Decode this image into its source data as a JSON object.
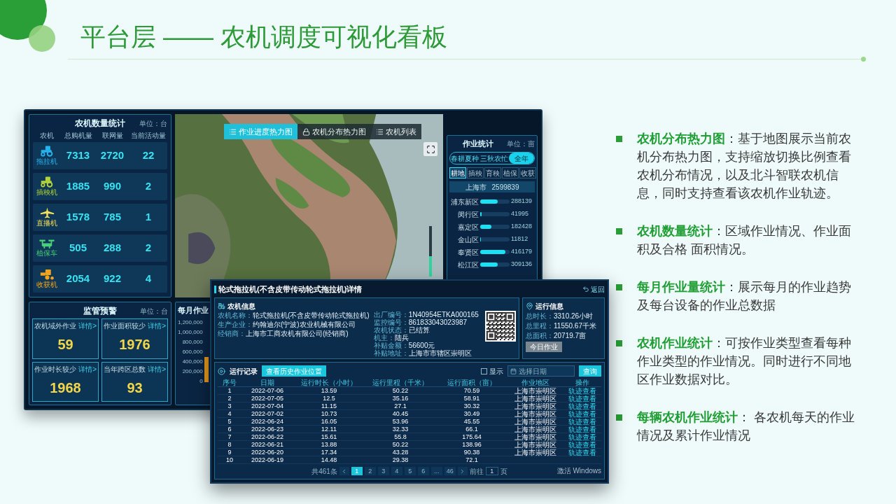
{
  "title": "平台层 —— 农机调度可视化看板",
  "dashboard": {
    "machine_stats": {
      "title": "农机数量统计",
      "unit": "单位：台",
      "columns": [
        "农机",
        "总购机量",
        "联网量",
        "当前活动量"
      ],
      "rows": [
        {
          "kind": "tractor",
          "name": "拖拉机",
          "color": "#25b4f0",
          "total": "7313",
          "online": "2720",
          "active": "22"
        },
        {
          "kind": "transplanter",
          "name": "插秧机",
          "color": "#b4d43a",
          "total": "1885",
          "online": "990",
          "active": "2"
        },
        {
          "kind": "seeder",
          "name": "直播机",
          "color": "#f2df5c",
          "total": "1578",
          "online": "785",
          "active": "1"
        },
        {
          "kind": "drone",
          "name": "植保车",
          "color": "#49d07a",
          "total": "505",
          "online": "288",
          "active": "2"
        },
        {
          "kind": "harvester",
          "name": "收获机",
          "color": "#f2a51c",
          "total": "2054",
          "online": "922",
          "active": "4"
        }
      ]
    },
    "warnings": {
      "title": "监管预警",
      "unit": "单位：台",
      "cards": [
        {
          "label": "农机域外作业",
          "link": "详情>",
          "value": "59"
        },
        {
          "label": "作业面积较少",
          "link": "详情>",
          "value": "1976"
        },
        {
          "label": "作业时长较少",
          "link": "详情>",
          "value": "1968"
        },
        {
          "label": "当年跨区总数",
          "link": "详情>",
          "value": "93"
        }
      ]
    },
    "map": {
      "tabs": [
        {
          "label": "作业进度热力图",
          "selected": true
        },
        {
          "label": "农机分布热力图",
          "selected": false
        },
        {
          "label": "农机列表",
          "selected": false
        }
      ],
      "zoom": {
        "level": 0.4
      }
    },
    "work_stats": {
      "title": "作业统计",
      "unit": "单位：亩",
      "seasons": [
        {
          "label": "春耕夏种",
          "selected": false
        },
        {
          "label": "三秋农忙",
          "selected": false
        },
        {
          "label": "全年",
          "selected": true
        }
      ],
      "types": [
        {
          "label": "耕地",
          "selected": true
        },
        {
          "label": "插秧",
          "selected": false
        },
        {
          "label": "育秧",
          "selected": false
        },
        {
          "label": "植保",
          "selected": false
        },
        {
          "label": "收获",
          "selected": false
        }
      ],
      "total": {
        "label": "上海市",
        "value": "2599839"
      },
      "districts": [
        {
          "name": "浦东新区",
          "level": 0.6,
          "value": "288139"
        },
        {
          "name": "闵行区",
          "level": 0.05,
          "value": "41995"
        },
        {
          "name": "嘉定区",
          "level": 0.37,
          "value": "182428"
        },
        {
          "name": "金山区",
          "level": 0.02,
          "value": "11812"
        },
        {
          "name": "奉贤区",
          "level": 0.85,
          "value": "416179"
        },
        {
          "name": "松江区",
          "level": 0.6,
          "value": "309136"
        }
      ]
    },
    "monthly": {
      "title": "每月作业",
      "y_labels": [
        "1,200,000",
        "1,000,000",
        "800,000",
        "600,000",
        "400,000",
        "200,000",
        "0"
      ]
    }
  },
  "detail": {
    "title": "轮式拖拉机(不含皮带传动轮式拖拉机)详情",
    "back": "返回",
    "machine_info": {
      "title": "农机信息",
      "columns": [
        [
          {
            "label": "农机名称：",
            "value": "轮式拖拉机(不含皮带传动轮式拖拉机)"
          },
          {
            "label": "生产企业：",
            "value": "约翰迪尔(宁波)农业机械有限公司"
          },
          {
            "label": "经销商：",
            "value": "上海市工商农机有限公司(经销商)"
          }
        ],
        [
          {
            "label": "出厂编号：",
            "value": "1N40954ETKA000165"
          },
          {
            "label": "监控编号：",
            "value": "861833043023987"
          },
          {
            "label": "农机状态：",
            "value": "已结算"
          }
        ],
        [
          {
            "label": "机主：",
            "value": "陆兵"
          },
          {
            "label": "补贴金额：",
            "value": "56600元"
          },
          {
            "label": "补贴地址：",
            "value": "上海市市辖区崇明区"
          }
        ]
      ]
    },
    "run_info": {
      "title": "运行信息",
      "fields": [
        {
          "label": "总时长：",
          "value": "3310.26小时"
        },
        {
          "label": "总里程：",
          "value": "11550.67千米"
        },
        {
          "label": "总面积：",
          "value": "20719.7亩"
        }
      ],
      "button": "今日作业"
    },
    "records": {
      "title": "运行记录",
      "history_button": "查看历史作业位置",
      "show": {
        "label": "显示",
        "checked": false
      },
      "date": {
        "placeholder": "选择日期"
      },
      "search_button": "查询",
      "columns": [
        "序号",
        "日期",
        "运行时长（小时）",
        "运行里程（千米）",
        "运行面积（亩）",
        "作业地区",
        "操作"
      ],
      "rows": [
        {
          "no": "1",
          "date": "2022-07-06",
          "hours": "13.59",
          "km": "50.22",
          "area": "70.59",
          "region": "上海市崇明区",
          "action": "轨迹查看"
        },
        {
          "no": "2",
          "date": "2022-07-05",
          "hours": "12.5",
          "km": "35.16",
          "area": "58.91",
          "region": "上海市崇明区",
          "action": "轨迹查看"
        },
        {
          "no": "3",
          "date": "2022-07-04",
          "hours": "11.15",
          "km": "27.1",
          "area": "30.32",
          "region": "上海市崇明区",
          "action": "轨迹查看"
        },
        {
          "no": "4",
          "date": "2022-07-02",
          "hours": "10.73",
          "km": "40.45",
          "area": "30.49",
          "region": "上海市崇明区",
          "action": "轨迹查看"
        },
        {
          "no": "5",
          "date": "2022-06-24",
          "hours": "16.05",
          "km": "53.96",
          "area": "45.55",
          "region": "上海市崇明区",
          "action": "轨迹查看"
        },
        {
          "no": "6",
          "date": "2022-06-23",
          "hours": "12.11",
          "km": "32.33",
          "area": "66.1",
          "region": "上海市崇明区",
          "action": "轨迹查看"
        },
        {
          "no": "7",
          "date": "2022-06-22",
          "hours": "15.61",
          "km": "55.8",
          "area": "175.64",
          "region": "上海市崇明区",
          "action": "轨迹查看"
        },
        {
          "no": "8",
          "date": "2022-06-21",
          "hours": "13.88",
          "km": "50.22",
          "area": "138.96",
          "region": "上海市崇明区",
          "action": "轨迹查看"
        },
        {
          "no": "9",
          "date": "2022-06-20",
          "hours": "17.34",
          "km": "43.28",
          "area": "90.38",
          "region": "上海市崇明区",
          "action": "轨迹查看"
        },
        {
          "no": "10",
          "date": "2022-06-19",
          "hours": "14.48",
          "km": "29.38",
          "area": "72.1"
        }
      ],
      "pagination": {
        "total": "共461条",
        "pages": [
          {
            "label": "1",
            "selected": true
          },
          {
            "label": "2",
            "selected": false
          },
          {
            "label": "3",
            "selected": false
          },
          {
            "label": "4",
            "selected": false
          },
          {
            "label": "5",
            "selected": false
          },
          {
            "label": "6",
            "selected": false
          },
          {
            "label": "...",
            "selected": false
          },
          {
            "label": "46",
            "selected": false
          }
        ],
        "goto": "前往",
        "page": "1",
        "unit": "页"
      },
      "os_notice": "激活 Windows"
    }
  },
  "features": [
    "**农机分布热力图**：基于地图展示当前农机分布热力图，支持缩放切换比例查看农机分布情况，以及北斗智联农机信息，同时支持查看该农机作业轨迹。",
    "**农机数量统计**：区域作业情况、作业面积及合格 面积情况。",
    "**每月作业量统计**：展示每月的作业趋势及每台设备的作业总数据",
    "**农机作业统计**：可按作业类型查看每种作业类型的作业情况。同时进行不同地区作业数据对比。",
    "**每辆农机作业统计**： 各农机每天的作业情况及累计作业情况"
  ]
}
